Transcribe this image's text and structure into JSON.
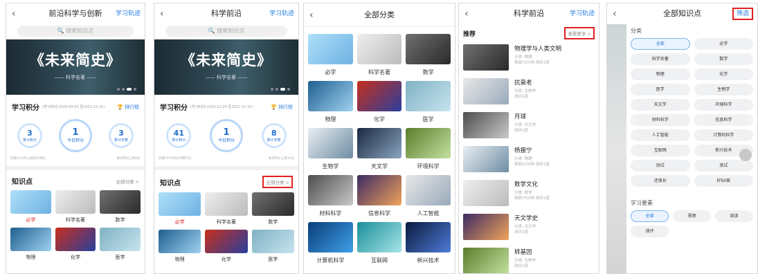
{
  "s1": {
    "back": "‹",
    "title": "前沿科学与创新",
    "right": "学习轨迹",
    "search": "搜索知识点",
    "banner_title": "《未来简史》",
    "banner_sub": "—— 科学名著 ——",
    "score_title": "学习积分",
    "score_period": "(学习时间 2019-09-01 至2021-12-31)",
    "rank": "排行榜",
    "c1": {
      "n": "3",
      "l": "累计积分"
    },
    "c2": {
      "n": "1",
      "l": "今日积分"
    },
    "c3": {
      "n": "3",
      "l": "累计天数"
    },
    "note_left": "近期13小时以后积分目标",
    "note_right": "每日积分上限6分",
    "kp_title": "知识点",
    "kp_more": "全部分类 >",
    "items": [
      "必学",
      "科学名著",
      "数学",
      "物理",
      "化学",
      "医学"
    ]
  },
  "s2": {
    "back": "‹",
    "title": "科学前沿",
    "right": "学习轨迹",
    "search": "搜索知识点",
    "banner_title": "《未来简史》",
    "banner_sub": "—— 科学名著 ——",
    "score_title": "学习积分",
    "score_period": "(学习时间 2020-12-29 至2021-12-31)",
    "rank": "排行榜",
    "c1": {
      "n": "41",
      "l": "累计积分"
    },
    "c2": {
      "n": "1",
      "l": "今日积分"
    },
    "c3": {
      "n": "8",
      "l": "累计天数"
    },
    "note_left": "近期1450积分可换学分",
    "note_right": "每日积分上限10分",
    "kp_title": "知识点",
    "kp_more": "全部分类 >",
    "items": [
      "必学",
      "科学名著",
      "数学",
      "物理",
      "化学",
      "医学"
    ]
  },
  "s3": {
    "back": "‹",
    "title": "全部分类",
    "items": [
      "必学",
      "科学名著",
      "数学",
      "物理",
      "化学",
      "医学",
      "生物学",
      "天文学",
      "环境科学",
      "材料科学",
      "信息科学",
      "人工智能",
      "计算机科学",
      "互联网",
      "新兴技术"
    ]
  },
  "s4": {
    "back": "‹",
    "title": "科学前沿",
    "right": "学习轨迹",
    "rec_title": "推荐",
    "rec_more": "查看更多 >",
    "list": [
      {
        "t": "物理学与人类文明",
        "a": "分类: 物理",
        "b": "视频72分钟 测评2道"
      },
      {
        "t": "抗衰老",
        "a": "分类: 生物学",
        "b": "测评2道"
      },
      {
        "t": "月球",
        "a": "分类: 天文学",
        "b": "测评2道"
      },
      {
        "t": "杨振宁",
        "a": "分类: 物理",
        "b": "视频20分钟 测评2道"
      },
      {
        "t": "数学文化",
        "a": "分类: 数学",
        "b": "视频75分钟 测评2道"
      },
      {
        "t": "天文学史",
        "a": "分类: 天文学",
        "b": "测评2道"
      },
      {
        "t": "转基因",
        "a": "分类: 生物学",
        "b": "测评2道"
      }
    ]
  },
  "s5": {
    "back": "‹",
    "title": "全部知识点",
    "filter": "筛选",
    "cat_title": "分类",
    "chips": [
      "全部",
      "必学",
      "科学名著",
      "数学",
      "物理",
      "化学",
      "医学",
      "生物学",
      "天文学",
      "环境科学",
      "材料科学",
      "信息科学",
      "人工智能",
      "计算机科学",
      "互联网",
      "新兴技术",
      "测试",
      "测试",
      "还很长",
      "好似l家"
    ],
    "elem_title": "学习要素",
    "elems": [
      "全部",
      "视频",
      "阅读",
      "测评"
    ]
  },
  "colors": {
    "accent": "#2b7fe0",
    "highlight": "#e02020"
  }
}
